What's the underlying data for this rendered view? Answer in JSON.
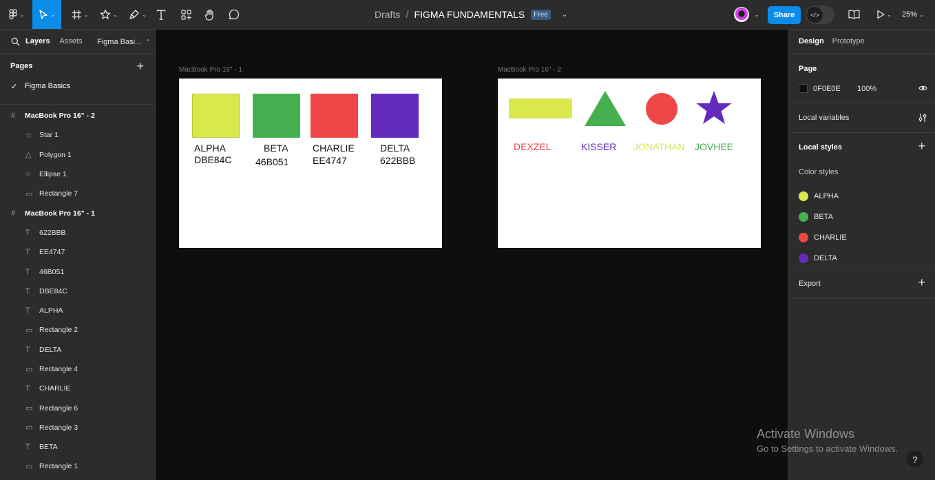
{
  "toolbar": {
    "breadcrumb_parent": "Drafts",
    "file_name": "FIGMA FUNDAMENTALS",
    "plan_badge": "Free",
    "share_label": "Share",
    "zoom_label": "25%",
    "tools": [
      "main-menu-icon",
      "move-tool-icon",
      "frame-tool-icon",
      "shape-tool-icon",
      "pen-tool-icon",
      "text-tool-icon",
      "resources-icon",
      "hand-tool-icon",
      "comment-icon"
    ],
    "accent_color": "#0c8ce9"
  },
  "left_panel": {
    "tabs": {
      "layers": "Layers",
      "assets": "Assets",
      "page_selector": "Figma Basi..."
    },
    "pages_title": "Pages",
    "pages": [
      "Figma Basics"
    ],
    "layers": [
      {
        "type": "frame",
        "icon": "frame-icon",
        "label": "MacBook Pro 16\" - 2"
      },
      {
        "type": "child",
        "icon": "star-icon",
        "label": "Star 1"
      },
      {
        "type": "child",
        "icon": "polygon-icon",
        "label": "Polygon 1"
      },
      {
        "type": "child",
        "icon": "ellipse-icon",
        "label": "Ellipse 1"
      },
      {
        "type": "child",
        "icon": "rectangle-icon",
        "label": "Rectangle 7"
      },
      {
        "type": "frame",
        "icon": "frame-icon",
        "label": "MacBook Pro 16\" - 1"
      },
      {
        "type": "child",
        "icon": "text-icon",
        "label": "622BBB"
      },
      {
        "type": "child",
        "icon": "text-icon",
        "label": "EE4747"
      },
      {
        "type": "child",
        "icon": "text-icon",
        "label": "46B051"
      },
      {
        "type": "child",
        "icon": "text-icon",
        "label": "DBE84C"
      },
      {
        "type": "child",
        "icon": "text-icon",
        "label": "ALPHA"
      },
      {
        "type": "child",
        "icon": "rectangle-icon",
        "label": "Rectangle 2"
      },
      {
        "type": "child",
        "icon": "text-icon",
        "label": "DELTA"
      },
      {
        "type": "child",
        "icon": "rectangle-icon",
        "label": "Rectangle 4"
      },
      {
        "type": "child",
        "icon": "text-icon",
        "label": "CHARLIE"
      },
      {
        "type": "child",
        "icon": "rectangle-icon",
        "label": "Rectangle 6"
      },
      {
        "type": "child",
        "icon": "rectangle-icon",
        "label": "Rectangle 3"
      },
      {
        "type": "child",
        "icon": "text-icon",
        "label": "BETA"
      },
      {
        "type": "child",
        "icon": "rectangle-icon",
        "label": "Rectangle 1"
      }
    ]
  },
  "canvas": {
    "frame1": {
      "label": "MacBook Pro 16\" - 1",
      "swatches": [
        {
          "name": "ALPHA",
          "hex": "DBE84C",
          "color": "#dbe84c"
        },
        {
          "name": "BETA",
          "hex": "46B051",
          "color": "#46b051"
        },
        {
          "name": "CHARLIE",
          "hex": "EE4747",
          "color": "#ee4747"
        },
        {
          "name": "DELTA",
          "hex": "622BBB",
          "color": "#622bbb"
        }
      ]
    },
    "frame2": {
      "label": "MacBook Pro 16\" - 2",
      "words": [
        {
          "text": "DEXZEL",
          "color": "#ee4747"
        },
        {
          "text": "KISSER",
          "color": "#622bbb"
        },
        {
          "text": "JONATHAN",
          "color": "#dbe84c"
        },
        {
          "text": "JOVHEE",
          "color": "#46b051"
        }
      ]
    }
  },
  "right_panel": {
    "tabs": {
      "design": "Design",
      "prototype": "Prototype"
    },
    "page_section": {
      "title": "Page",
      "color_hex": "0F0E0E",
      "opacity": "100%"
    },
    "local_variables": "Local variables",
    "local_styles": "Local styles",
    "color_styles_title": "Color styles",
    "color_styles": [
      {
        "name": "ALPHA",
        "color": "#dbe84c"
      },
      {
        "name": "BETA",
        "color": "#46b051"
      },
      {
        "name": "CHARLIE",
        "color": "#ee4747"
      },
      {
        "name": "DELTA",
        "color": "#622bbb"
      }
    ],
    "export": "Export"
  },
  "overlay": {
    "activate_title": "Activate Windows",
    "activate_sub": "Go to Settings to activate Windows.",
    "help": "?"
  }
}
